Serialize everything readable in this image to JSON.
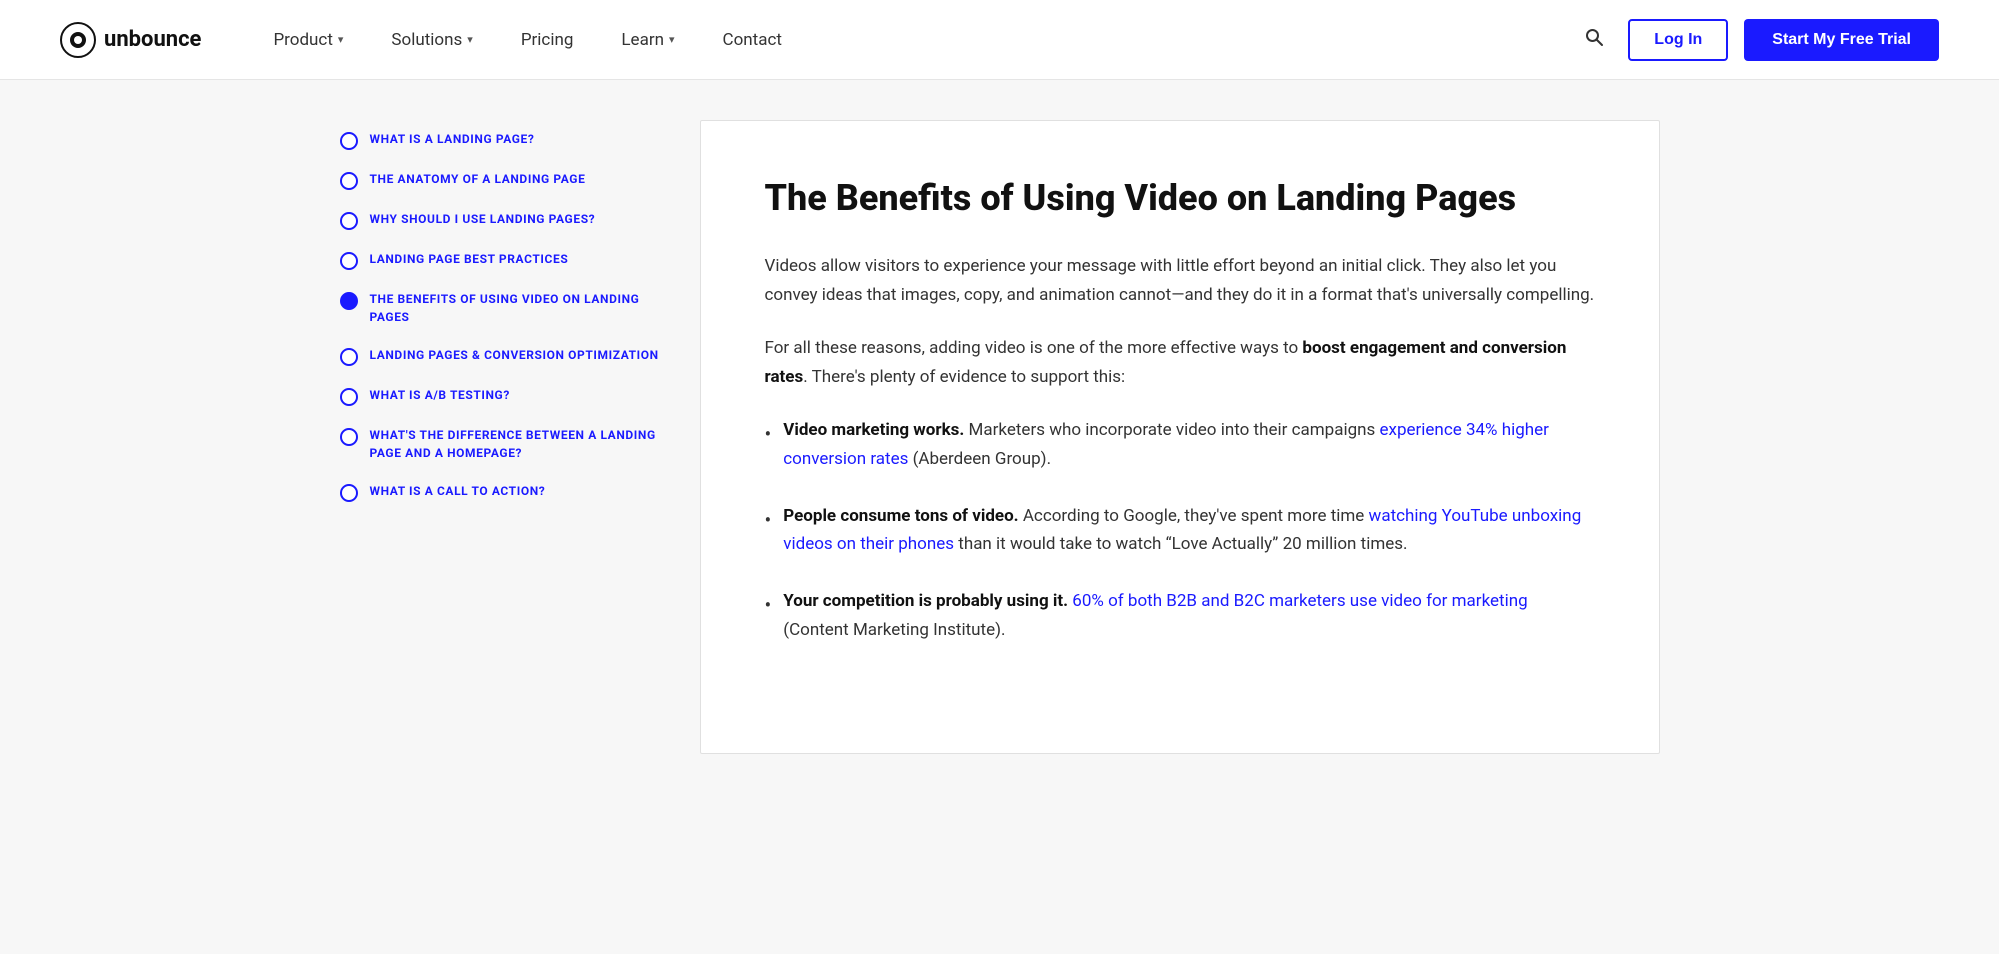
{
  "header": {
    "logo_text": "unbounce",
    "nav_items": [
      {
        "label": "Product",
        "has_dropdown": true
      },
      {
        "label": "Solutions",
        "has_dropdown": true
      },
      {
        "label": "Pricing",
        "has_dropdown": false
      },
      {
        "label": "Learn",
        "has_dropdown": true
      },
      {
        "label": "Contact",
        "has_dropdown": false
      }
    ],
    "login_label": "Log In",
    "trial_label": "Start My Free Trial"
  },
  "sidebar": {
    "items": [
      {
        "label": "What is a landing page?",
        "active": false
      },
      {
        "label": "The anatomy of a landing page",
        "active": false
      },
      {
        "label": "Why should I use landing pages?",
        "active": false
      },
      {
        "label": "Landing page best practices",
        "active": false
      },
      {
        "label": "The benefits of using video on landing pages",
        "active": true
      },
      {
        "label": "Landing pages & conversion optimization",
        "active": false
      },
      {
        "label": "What is A/B testing?",
        "active": false
      },
      {
        "label": "What's the difference between a landing page and a homepage?",
        "active": false
      },
      {
        "label": "What is a call to action?",
        "active": false
      }
    ]
  },
  "article": {
    "title": "The Benefits of Using Video on Landing Pages",
    "intro_p1": "Videos allow visitors to experience your message with little effort beyond an initial click. They also let you convey ideas that images, copy, and animation cannot—and they do it in a format that's universally compelling.",
    "intro_p2_prefix": "For all these reasons, adding video is one of the more effective ways to ",
    "intro_p2_bold": "boost engagement and conversion rates",
    "intro_p2_suffix": ". There's plenty of evidence to support this:",
    "bullets": [
      {
        "bold": "Video marketing works.",
        "text_before": " Marketers who incorporate video into their campaigns ",
        "link_text": "experience 34% higher conversion rates",
        "text_after": " (Aberdeen Group)."
      },
      {
        "bold": "People consume tons of video.",
        "text_before": " According to Google, they've spent more time ",
        "link_text": "watching YouTube unboxing videos on their phones",
        "text_after": " than it would take to watch “Love Actually” 20 million times."
      },
      {
        "bold": "Your competition is probably using it.",
        "text_before": " ",
        "link_text": "60% of both B2B and B2C marketers use video for marketing",
        "text_after": " (Content Marketing Institute)."
      }
    ]
  },
  "icons": {
    "search": "🔍",
    "chevron_down": "▾"
  }
}
